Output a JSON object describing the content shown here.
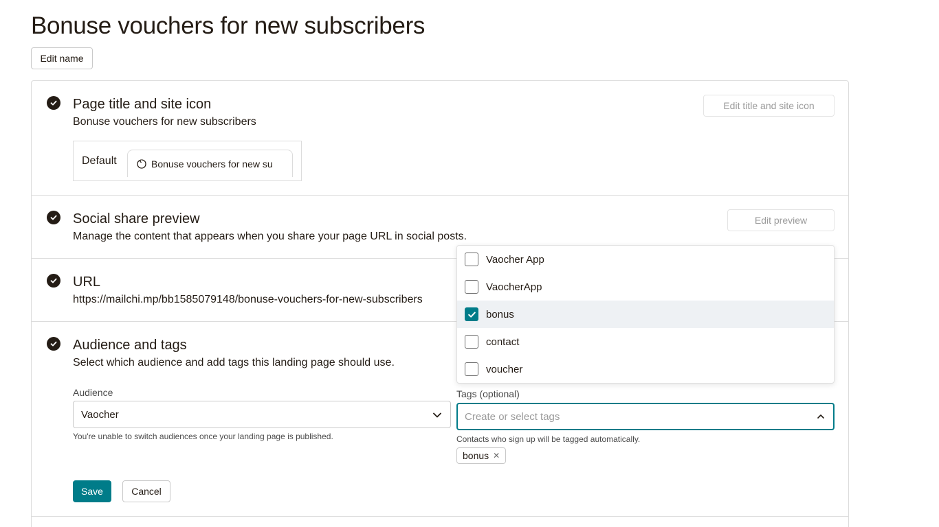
{
  "page": {
    "title": "Bonuse vouchers for new subscribers",
    "edit_name_label": "Edit name"
  },
  "sections": {
    "page_title": {
      "title": "Page title and site icon",
      "subtitle": "Bonuse vouchers for new subscribers",
      "action_label": "Edit title and site icon",
      "preview": {
        "default_label": "Default",
        "tab_text": "Bonuse vouchers for new su"
      }
    },
    "social": {
      "title": "Social share preview",
      "subtitle": "Manage the content that appears when you share your page URL in social posts.",
      "action_label": "Edit preview"
    },
    "url": {
      "title": "URL",
      "value": "https://mailchi.mp/bb1585079148/bonuse-vouchers-for-new-subscribers"
    },
    "audience": {
      "title": "Audience and tags",
      "subtitle": "Select which audience and add tags this landing page should use.",
      "audience_label": "Audience",
      "audience_value": "Vaocher",
      "audience_help": "You're unable to switch audiences once your landing page is published.",
      "tags_label": "Tags (optional)",
      "tags_placeholder": "Create or select tags",
      "tags_help": "Contacts who sign up will be tagged automatically.",
      "selected_tag": "bonus",
      "save_label": "Save",
      "cancel_label": "Cancel"
    }
  },
  "tag_options": [
    {
      "label": "Vaocher App",
      "checked": false
    },
    {
      "label": "VaocherApp",
      "checked": false
    },
    {
      "label": "bonus",
      "checked": true
    },
    {
      "label": "contact",
      "checked": false
    },
    {
      "label": "voucher",
      "checked": false
    }
  ],
  "colors": {
    "accent": "#007c89",
    "text": "#241c15",
    "border": "#dcdcdc"
  }
}
